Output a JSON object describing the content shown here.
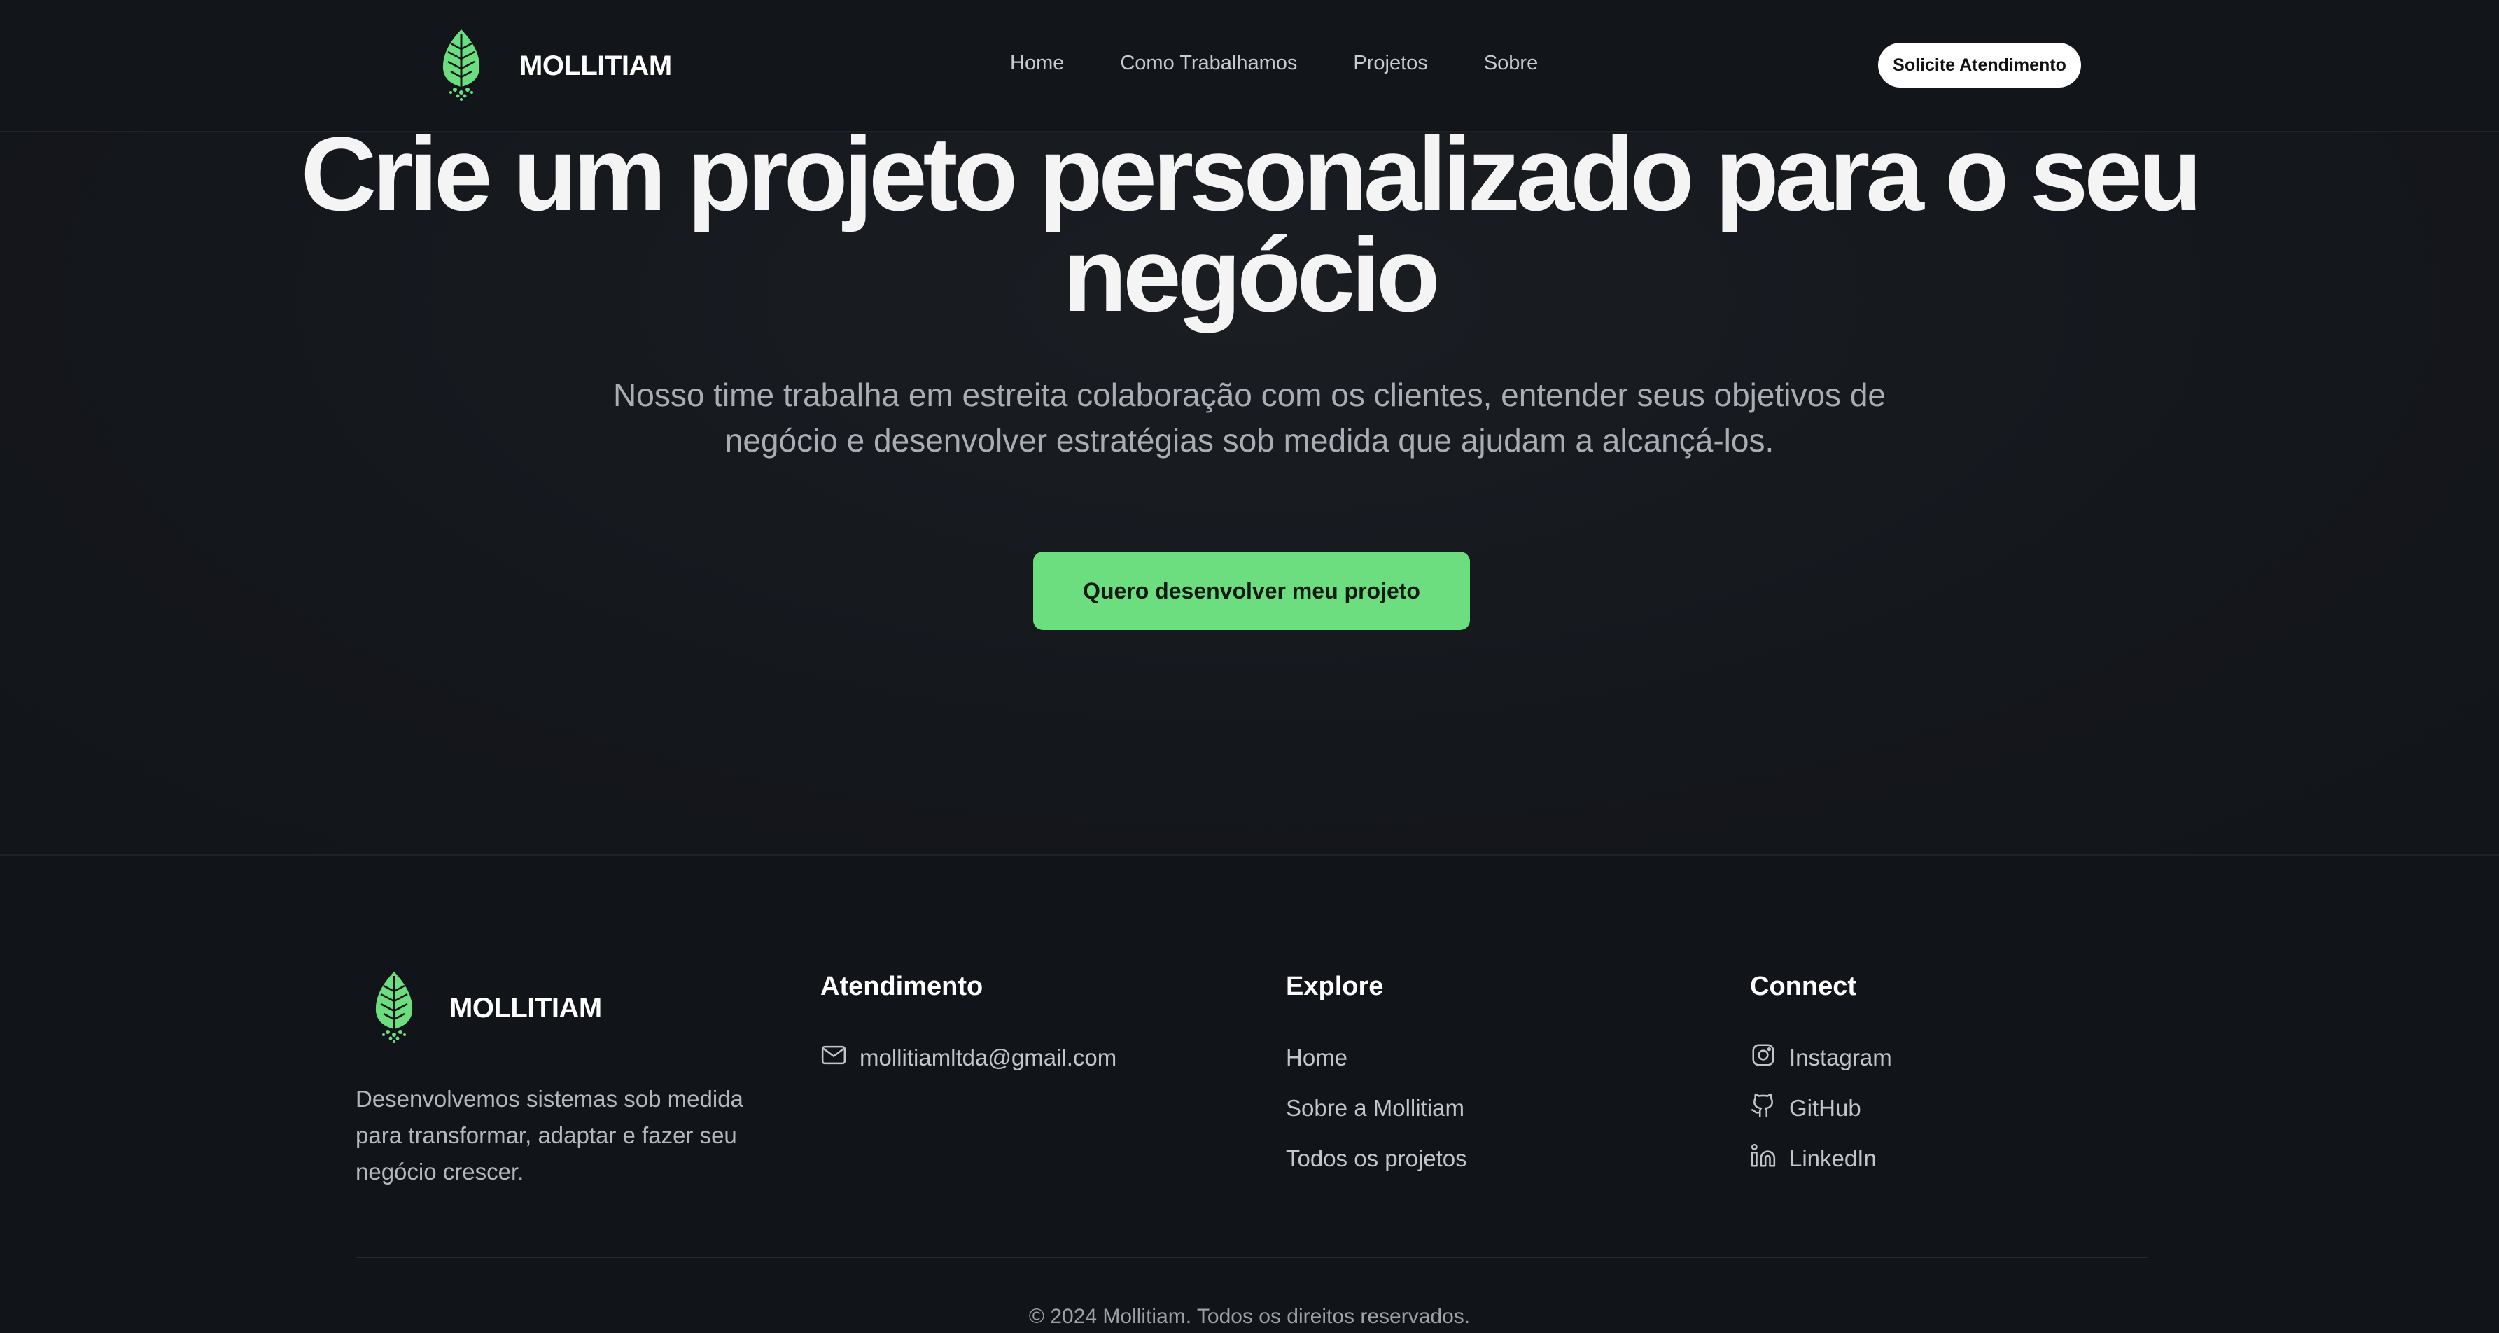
{
  "header": {
    "brand": "MOLLITIAM",
    "nav": [
      "Home",
      "Como Trabalhamos",
      "Projetos",
      "Sobre"
    ],
    "cta_label": "Solicite Atendimento"
  },
  "hero": {
    "title": "Crie um projeto personalizado para o seu negócio",
    "subtitle": "Nosso time trabalha em estreita colaboração com os clientes, entender seus objetivos de negócio e desenvolver estratégias sob medida que ajudam a alcançá-los.",
    "cta_label": "Quero desenvolver meu projeto"
  },
  "footer": {
    "brand": "MOLLITIAM",
    "description": "Desenvolvemos sistemas sob medida para transformar, adaptar e fazer seu negócio crescer.",
    "atendimento": {
      "title": "Atendimento",
      "email": "mollitiamltda@gmail.com"
    },
    "explore": {
      "title": "Explore",
      "links": [
        "Home",
        "Sobre a Mollitiam",
        "Todos os projetos"
      ]
    },
    "connect": {
      "title": "Connect",
      "links": [
        "Instagram",
        "GitHub",
        "LinkedIn"
      ]
    },
    "copyright": "© 2024 Mollitiam. Todos os direitos reservados."
  },
  "icons": {
    "logo": "leaf-icon",
    "email": "mail-icon",
    "instagram": "instagram-icon",
    "github": "github-icon",
    "linkedin": "linkedin-icon"
  },
  "colors": {
    "background": "#12151a",
    "accent": "#6dde7f",
    "text": "#ffffff",
    "muted": "#a9adb4"
  }
}
